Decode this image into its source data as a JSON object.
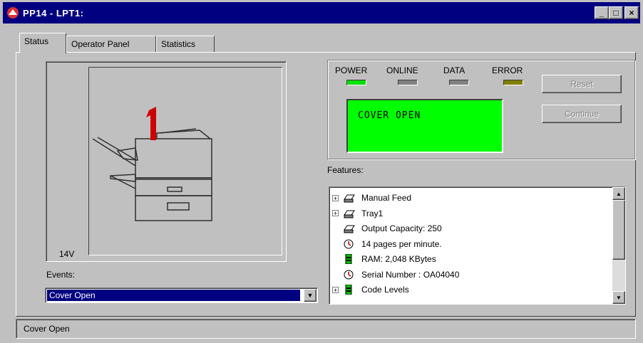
{
  "window": {
    "title": "PP14 - LPT1:",
    "controls": {
      "minimize": "_",
      "maximize": "□",
      "close": "×"
    }
  },
  "tabs": [
    {
      "label": "Status",
      "active": true
    },
    {
      "label": "Operator Panel",
      "active": false
    },
    {
      "label": "Statistics",
      "active": false
    }
  ],
  "printer": {
    "model_label": "14V"
  },
  "events": {
    "label": "Events:",
    "selected": "Cover Open"
  },
  "leds": [
    {
      "label": "POWER",
      "color": "#00e000"
    },
    {
      "label": "ONLINE",
      "color": "#808080"
    },
    {
      "label": "DATA",
      "color": "#808080"
    },
    {
      "label": "ERROR",
      "color": "#808000"
    }
  ],
  "lcd": {
    "text": "COVER OPEN",
    "background": "#00ff00"
  },
  "buttons": {
    "reset": "Reset",
    "continue": "Continue"
  },
  "features": {
    "label": "Features:",
    "items": [
      {
        "text": "Manual Feed",
        "expandable": true,
        "icon": "printer-icon"
      },
      {
        "text": "Tray1",
        "expandable": true,
        "icon": "printer-icon"
      },
      {
        "text": "Output Capacity: 250",
        "expandable": false,
        "icon": "printer-icon"
      },
      {
        "text": "14 pages per minute.",
        "expandable": false,
        "icon": "clock-icon"
      },
      {
        "text": "RAM:  2,048 KBytes",
        "expandable": false,
        "icon": "memory-chip-icon"
      },
      {
        "text": "Serial Number :  OA04040",
        "expandable": false,
        "icon": "clock-icon"
      },
      {
        "text": "Code Levels",
        "expandable": true,
        "icon": "memory-chip-icon"
      }
    ]
  },
  "status_bar": {
    "text": "Cover Open"
  },
  "colors": {
    "title_bar": "#000080",
    "face": "#c0c0c0",
    "selection": "#000080",
    "error_indicator": "#cc0000"
  }
}
